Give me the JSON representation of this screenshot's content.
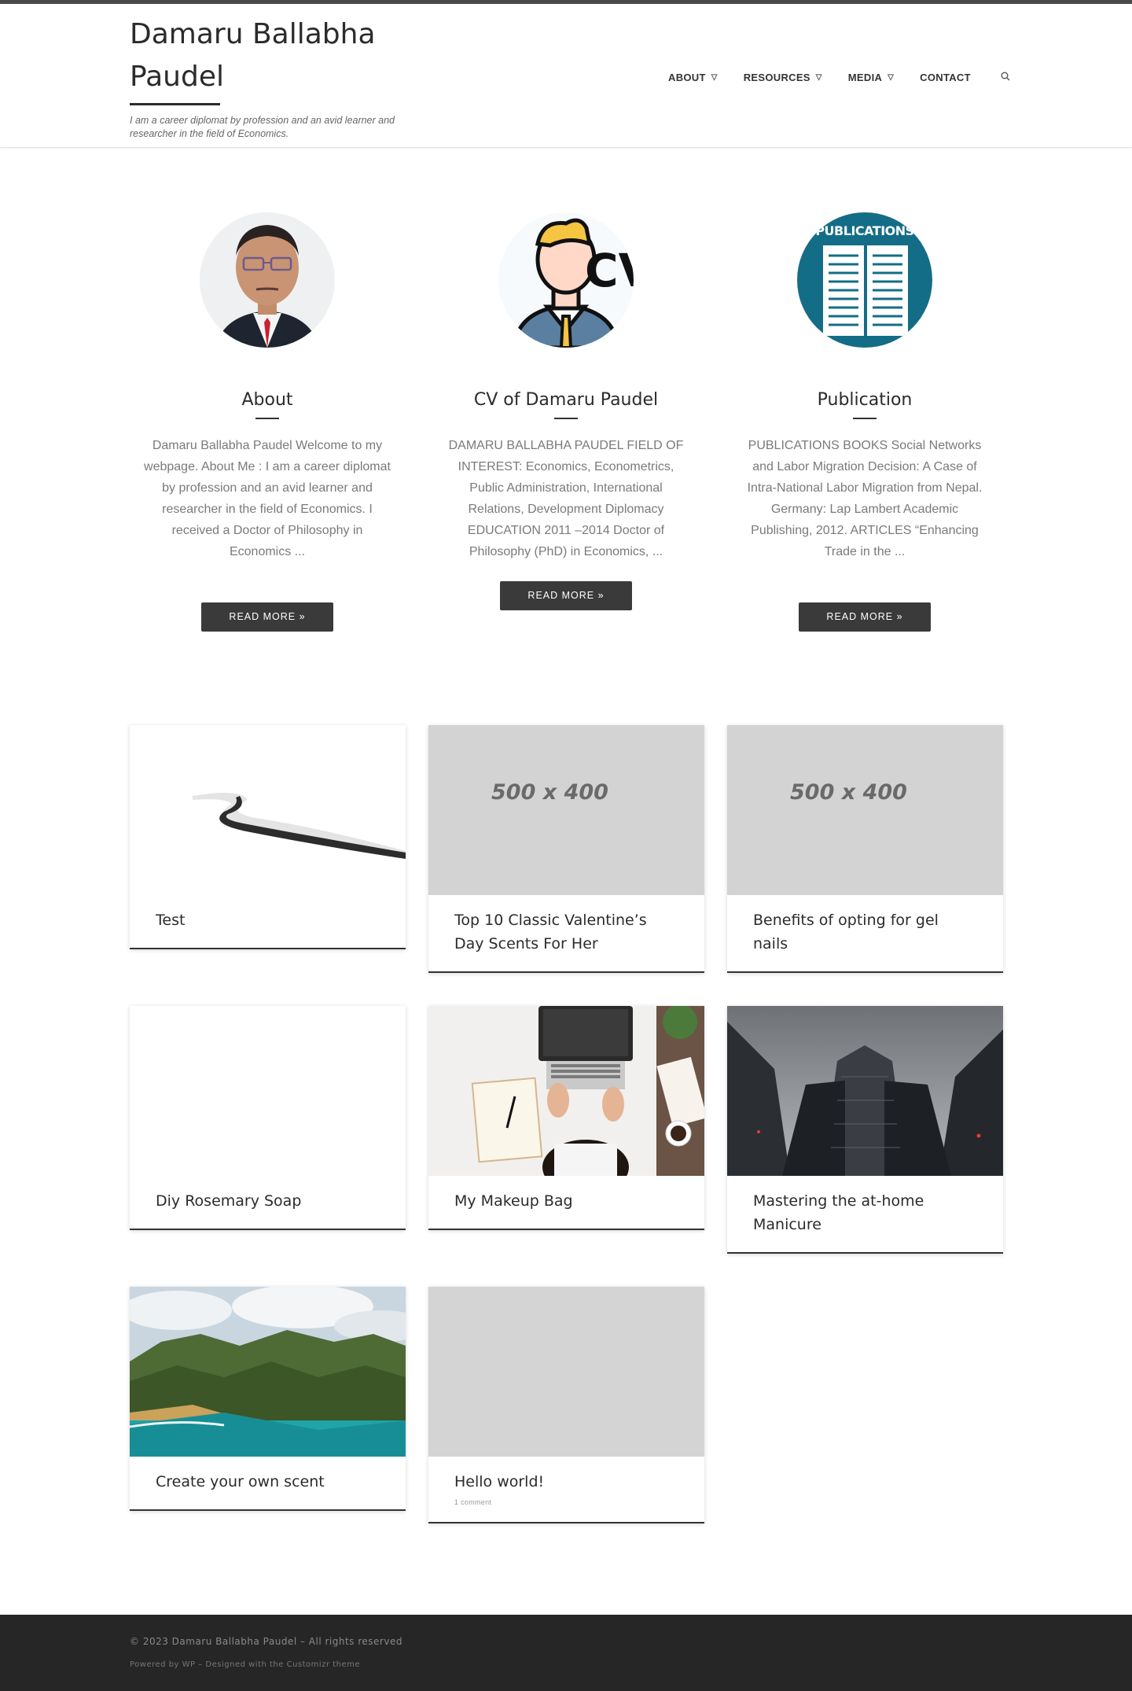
{
  "header": {
    "site_title": "Damaru Ballabha Paudel",
    "tagline": "I am a career diplomat by profession and an avid learner and researcher in the field of Economics.",
    "nav": [
      {
        "label": "ABOUT",
        "has_dropdown": true
      },
      {
        "label": "RESOURCES",
        "has_dropdown": true
      },
      {
        "label": "MEDIA",
        "has_dropdown": true
      },
      {
        "label": "CONTACT",
        "has_dropdown": false
      }
    ],
    "search_icon": "search-icon"
  },
  "featured": [
    {
      "title": "About",
      "text": "Damaru Ballabha Paudel Welcome to my webpage. About Me : I am a career diplomat by profession and an avid learner and researcher in the field of Economics. I received a Doctor of Philosophy in Economics ...",
      "button": "READ MORE »"
    },
    {
      "title": "CV of Damaru Paudel",
      "image_text": "CV",
      "text": "DAMARU BALLABHA PAUDEL FIELD OF INTEREST: Economics, Econometrics, Public Administration, International Relations, Development Diplomacy EDUCATION 2011 –2014 Doctor of Philosophy (PhD) in Economics, ...",
      "button": "READ MORE »"
    },
    {
      "title": "Publication",
      "image_text": "PUBLICATIONS",
      "text": "PUBLICATIONS BOOKS Social Networks and Labor Migration Decision: A Case of Intra-National Labor Migration from Nepal. Germany: Lap Lambert Academic Publishing, 2012. ARTICLES “Enhancing Trade in the ...",
      "button": "READ MORE »"
    }
  ],
  "posts": [
    {
      "title": "Test",
      "image": "road-aerial"
    },
    {
      "title": "Top 10 Classic Valentine’s Day Scents For Her",
      "image": "placeholder",
      "placeholder_text": "500 x 400"
    },
    {
      "title": "Benefits of opting for gel nails",
      "image": "placeholder",
      "placeholder_text": "500 x 400"
    },
    {
      "title": "Diy Rosemary Soap",
      "image": "blank"
    },
    {
      "title": "My Makeup Bag",
      "image": "laptop-desk"
    },
    {
      "title": "Mastering the at-home Manicure",
      "image": "skyscrapers"
    },
    {
      "title": "Create your own scent",
      "image": "coastline"
    },
    {
      "title": "Hello world!",
      "image": "gray",
      "meta": "1 comment"
    }
  ],
  "footer": {
    "copyright": "© 2023 Damaru Ballabha Paudel – All rights reserved",
    "credit": "Powered by WP – Designed with the Customizr theme"
  }
}
